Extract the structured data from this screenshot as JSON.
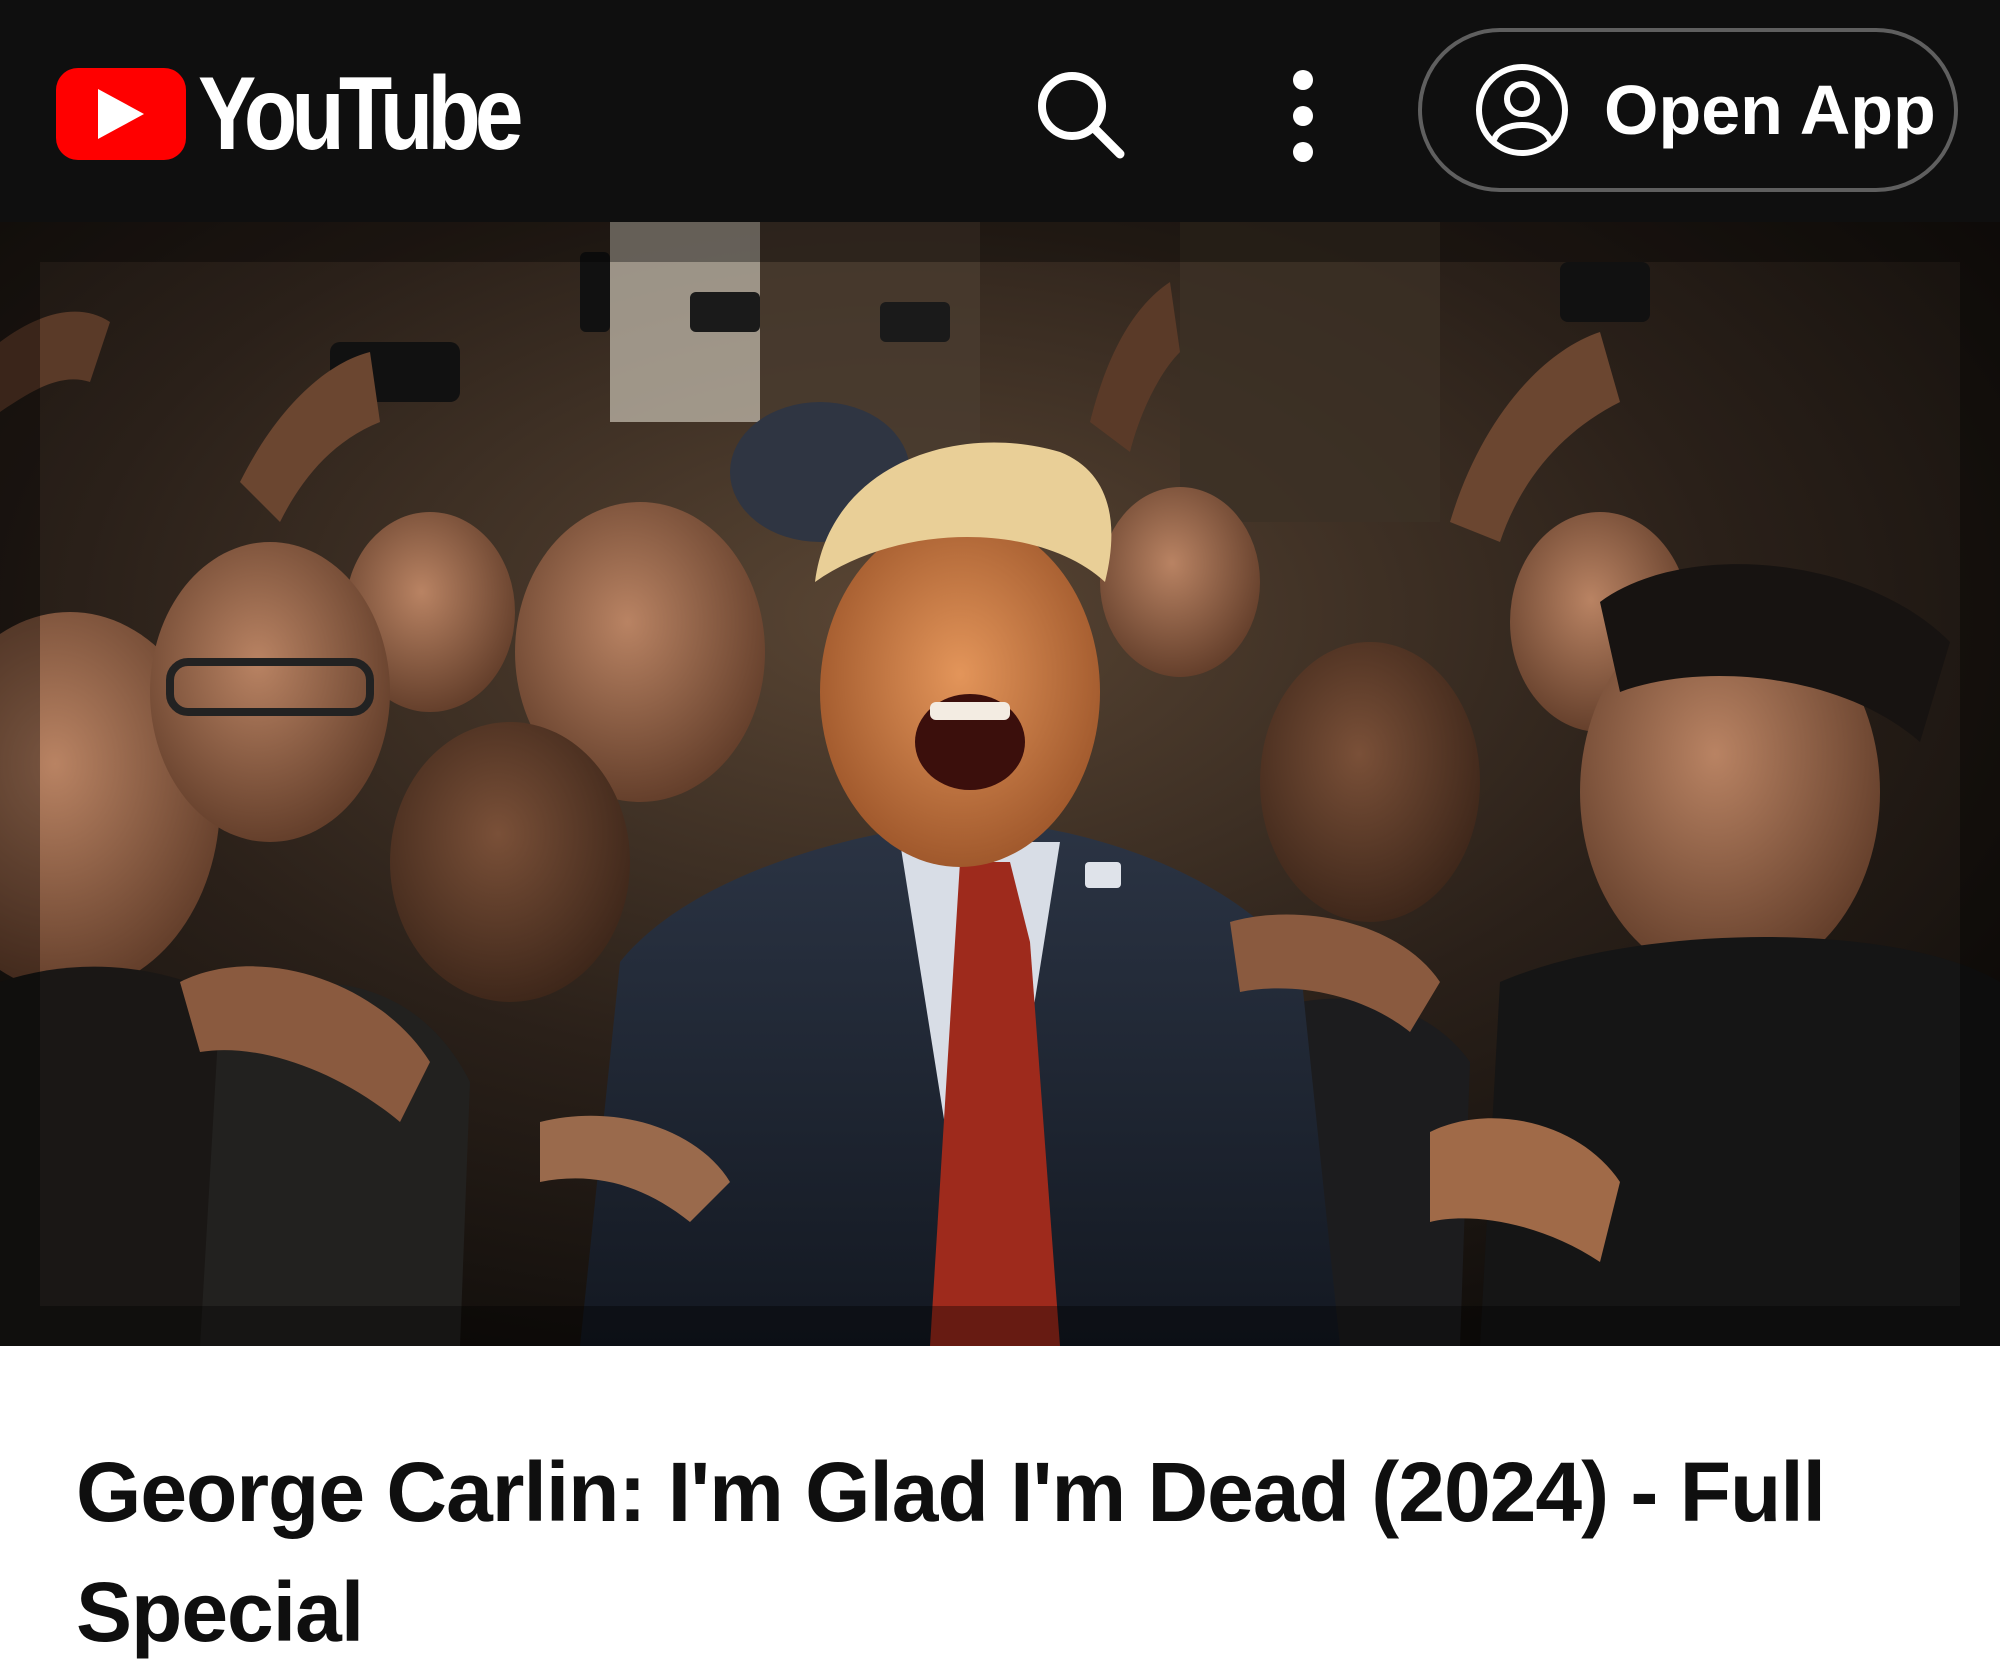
{
  "header": {
    "logo_text": "YouTube",
    "open_app_label": "Open App",
    "icons": {
      "logo": "youtube-play-icon",
      "search": "search-icon",
      "more": "more-vert-icon",
      "account": "account-circle-icon"
    },
    "colors": {
      "background": "#0f0f0f",
      "brand_red": "#ff0000"
    }
  },
  "video": {
    "title": "George Carlin: I'm Glad I'm Dead (2024) - Full Special"
  }
}
